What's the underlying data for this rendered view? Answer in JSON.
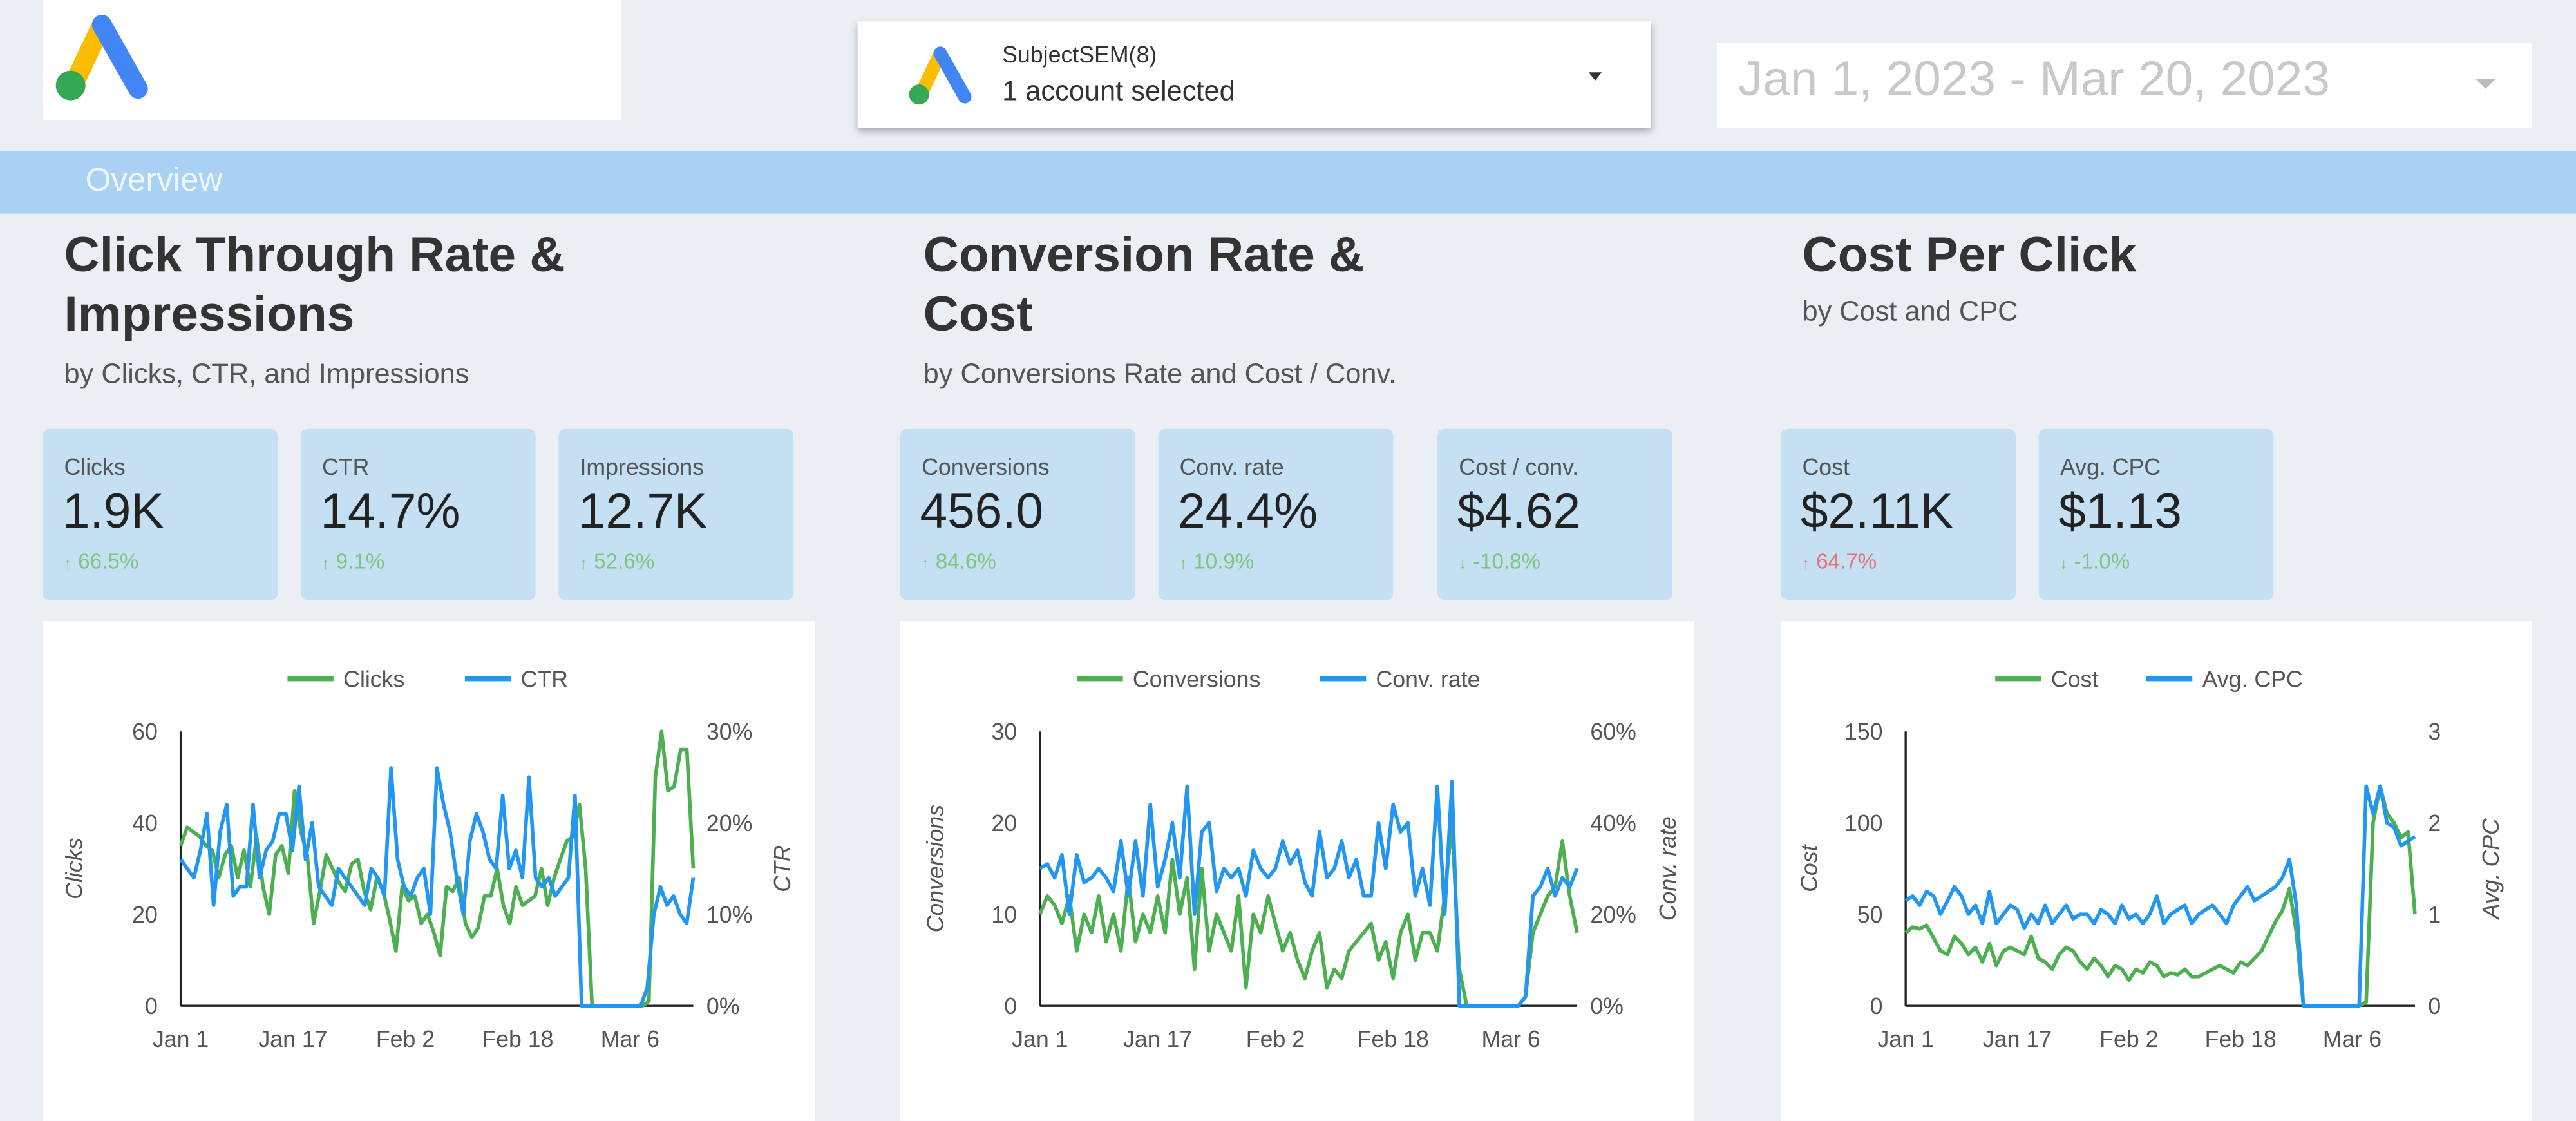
{
  "header": {
    "account_selector": {
      "name": "SubjectSEM(8)",
      "status": "1 account selected",
      "icon": "google-ads-logo"
    },
    "date_range": "Jan 1, 2023 - Mar 20, 2023"
  },
  "nav": {
    "overview_label": "Overview"
  },
  "colors": {
    "accent_band": "#a8d1f3",
    "kpi_bg": "#c5dff3",
    "series_green": "#4caf50",
    "series_blue": "#2196f3",
    "delta_positive": "#7cc67c",
    "delta_negative": "#e57373"
  },
  "sections": [
    {
      "title_line1": "Click Through Rate &",
      "title_line2": "Impressions",
      "subtitle": "by Clicks, CTR, and Impressions",
      "kpis": [
        {
          "label": "Clicks",
          "value": "1.9K",
          "delta": "66.5%",
          "dir": "up",
          "good": true
        },
        {
          "label": "CTR",
          "value": "14.7%",
          "delta": "9.1%",
          "dir": "up",
          "good": true
        },
        {
          "label": "Impressions",
          "value": "12.7K",
          "delta": "52.6%",
          "dir": "up",
          "good": true
        }
      ]
    },
    {
      "title_line1": "Conversion Rate &",
      "title_line2": "Cost",
      "subtitle": "by Conversions Rate and Cost / Conv.",
      "kpis": [
        {
          "label": "Conversions",
          "value": "456.0",
          "delta": "84.6%",
          "dir": "up",
          "good": true
        },
        {
          "label": "Conv. rate",
          "value": "24.4%",
          "delta": "10.9%",
          "dir": "up",
          "good": true
        },
        {
          "label": "Cost / conv.",
          "value": "$4.62",
          "delta": "-10.8%",
          "dir": "down",
          "good": true
        }
      ]
    },
    {
      "title_line1": "Cost Per Click",
      "title_line2": "",
      "subtitle": "by Cost and CPC",
      "kpis": [
        {
          "label": "Cost",
          "value": "$2.11K",
          "delta": "64.7%",
          "dir": "up",
          "good": false
        },
        {
          "label": "Avg. CPC",
          "value": "$1.13",
          "delta": "-1.0%",
          "dir": "down",
          "good": true
        }
      ]
    }
  ],
  "chart_data": [
    {
      "type": "line",
      "x_ticks": [
        "Jan 1",
        "Jan 17",
        "Feb 2",
        "Feb 18",
        "Mar 6"
      ],
      "x_tick_days": [
        0,
        16,
        32,
        48,
        64
      ],
      "ylabel": "Clicks",
      "y2label": "CTR",
      "ylim": [
        0,
        60
      ],
      "y2lim": [
        0,
        30
      ],
      "y_ticks": [
        "0",
        "20",
        "40",
        "60"
      ],
      "y2_ticks": [
        "0%",
        "10%",
        "20%",
        "30%"
      ],
      "legend": "top",
      "grid": false,
      "series": [
        {
          "name": "Clicks",
          "axis": "left",
          "color": "#4caf50",
          "values": [
            35,
            39,
            38,
            37,
            35,
            34,
            28,
            33,
            35,
            28,
            34,
            26,
            37,
            26,
            20,
            33,
            35,
            29,
            47,
            38,
            33,
            18,
            25,
            33,
            30,
            27,
            25,
            31,
            32,
            25,
            21,
            28,
            25,
            19,
            12,
            26,
            23,
            24,
            18,
            20,
            16,
            11,
            26,
            25,
            28,
            18,
            15,
            17,
            24,
            24,
            30,
            22,
            18,
            26,
            22,
            23,
            24,
            30,
            22,
            28,
            32,
            36,
            37,
            44,
            30,
            0,
            0,
            0,
            0,
            0,
            0,
            0,
            0,
            0,
            1,
            50,
            60,
            47,
            48,
            56,
            56,
            30
          ]
        },
        {
          "name": "CTR",
          "axis": "right",
          "color": "#2196f3",
          "values": [
            16,
            15,
            14,
            17,
            21,
            11,
            19,
            22,
            12,
            13,
            13,
            22,
            14,
            17,
            18,
            21,
            21,
            17,
            24,
            16,
            20,
            13,
            12,
            11,
            15,
            14,
            13,
            12,
            11,
            15,
            14,
            12,
            26,
            16,
            13,
            12,
            14,
            15,
            10,
            26,
            22,
            19,
            14,
            10,
            18,
            21,
            19,
            16,
            15,
            23,
            15,
            17,
            14,
            25,
            14,
            13,
            14,
            12,
            13,
            14,
            23,
            0,
            0,
            0,
            0,
            0,
            0,
            0,
            0,
            0,
            0,
            2,
            10,
            13,
            11,
            12,
            10,
            9,
            14
          ]
        }
      ]
    },
    {
      "type": "line",
      "x_ticks": [
        "Jan 1",
        "Jan 17",
        "Feb 2",
        "Feb 18",
        "Mar 6"
      ],
      "x_tick_days": [
        0,
        16,
        32,
        48,
        64
      ],
      "ylabel": "Conversions",
      "y2label": "Conv. rate",
      "ylim": [
        0,
        30
      ],
      "y2lim": [
        0,
        60
      ],
      "y_ticks": [
        "0",
        "10",
        "20",
        "30"
      ],
      "y2_ticks": [
        "0%",
        "20%",
        "40%",
        "60%"
      ],
      "legend": "top",
      "grid": false,
      "series": [
        {
          "name": "Conversions",
          "axis": "left",
          "color": "#4caf50",
          "values": [
            10,
            12,
            11,
            9,
            12,
            6,
            10,
            8,
            12,
            7,
            10,
            6,
            14,
            7,
            10,
            8,
            12,
            8,
            16,
            10,
            14,
            4,
            15,
            6,
            10,
            8,
            6,
            12,
            2,
            10,
            8,
            12,
            9,
            6,
            8,
            5,
            3,
            6,
            8,
            2,
            4,
            3,
            6,
            7,
            8,
            9,
            5,
            7,
            3,
            8,
            10,
            5,
            8,
            8,
            6,
            12,
            20,
            4,
            0,
            0,
            0,
            0,
            0,
            0,
            0,
            0,
            1,
            8,
            10,
            12,
            13,
            18,
            12,
            8
          ]
        },
        {
          "name": "Conv. rate",
          "axis": "right",
          "color": "#2196f3",
          "values": [
            30,
            31,
            28,
            33,
            20,
            33,
            27,
            28,
            30,
            28,
            25,
            36,
            24,
            36,
            24,
            44,
            26,
            32,
            40,
            28,
            48,
            20,
            38,
            40,
            25,
            30,
            28,
            30,
            24,
            34,
            30,
            28,
            30,
            36,
            31,
            34,
            27,
            24,
            38,
            28,
            30,
            36,
            28,
            32,
            24,
            24,
            40,
            30,
            44,
            38,
            40,
            24,
            30,
            22,
            48,
            20,
            49,
            0,
            0,
            0,
            0,
            0,
            0,
            0,
            0,
            0,
            2,
            24,
            26,
            30,
            24,
            28,
            26,
            30
          ]
        }
      ]
    },
    {
      "type": "line",
      "x_ticks": [
        "Jan 1",
        "Jan 17",
        "Feb 2",
        "Feb 18",
        "Mar 6"
      ],
      "x_tick_days": [
        0,
        16,
        32,
        48,
        64
      ],
      "ylabel": "Cost",
      "y2label": "Avg. CPC",
      "ylim": [
        0,
        150
      ],
      "y2lim": [
        0,
        3
      ],
      "y_ticks": [
        "0",
        "50",
        "100",
        "150"
      ],
      "y2_ticks": [
        "0",
        "1",
        "2",
        "3"
      ],
      "legend": "top",
      "grid": false,
      "series": [
        {
          "name": "Cost",
          "axis": "left",
          "color": "#4caf50",
          "values": [
            40,
            43,
            42,
            44,
            37,
            30,
            28,
            38,
            34,
            28,
            32,
            24,
            34,
            22,
            30,
            32,
            30,
            28,
            38,
            26,
            24,
            20,
            28,
            32,
            30,
            24,
            20,
            26,
            22,
            16,
            22,
            20,
            14,
            20,
            18,
            24,
            22,
            16,
            18,
            17,
            20,
            16,
            16,
            18,
            20,
            22,
            20,
            18,
            24,
            22,
            26,
            30,
            38,
            46,
            52,
            64,
            40,
            0,
            0,
            0,
            0,
            0,
            0,
            0,
            0,
            0,
            2,
            100,
            120,
            105,
            100,
            92,
            95,
            50
          ]
        },
        {
          "name": "Avg. CPC",
          "axis": "right",
          "color": "#2196f3",
          "values": [
            1.15,
            1.2,
            1.1,
            1.25,
            1.2,
            1.0,
            1.15,
            1.3,
            1.2,
            1.0,
            1.1,
            0.9,
            1.25,
            0.9,
            1.0,
            1.1,
            1.05,
            0.85,
            1.0,
            0.9,
            1.1,
            0.9,
            1.0,
            1.1,
            0.95,
            1.0,
            1.0,
            0.9,
            1.05,
            1.0,
            0.9,
            1.1,
            0.95,
            1.0,
            0.9,
            1.0,
            1.2,
            0.9,
            1.0,
            1.05,
            1.1,
            0.9,
            1.0,
            1.05,
            1.1,
            1.0,
            0.9,
            1.1,
            1.2,
            1.3,
            1.15,
            1.2,
            1.25,
            1.3,
            1.4,
            1.6,
            1.1,
            0,
            0,
            0,
            0,
            0,
            0,
            0,
            0,
            0,
            2.4,
            2.1,
            2.4,
            2.0,
            1.95,
            1.75,
            1.8,
            1.85
          ]
        }
      ]
    }
  ]
}
